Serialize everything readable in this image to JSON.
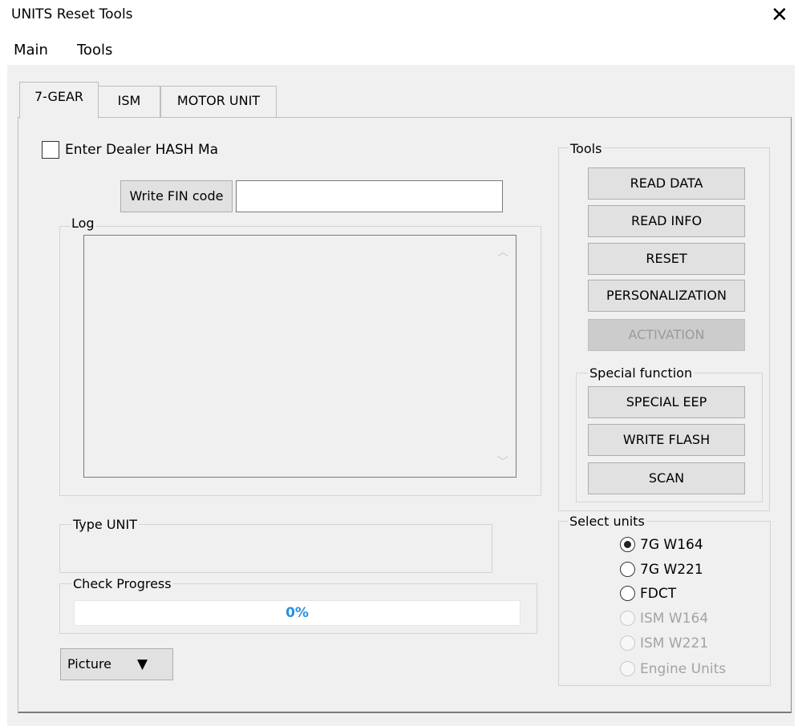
{
  "window": {
    "title": "UNITS Reset Tools",
    "close_label": "✕"
  },
  "menu": {
    "items": [
      "Main",
      "Tools"
    ]
  },
  "tabs": [
    "7-GEAR",
    "ISM",
    "MOTOR UNIT"
  ],
  "checkbox": {
    "label": "Enter Dealer HASH Ma",
    "checked": false
  },
  "write_fin": {
    "button_label": "Write FIN code",
    "value": ""
  },
  "log": {
    "label": "Log",
    "content": ""
  },
  "tools": {
    "label": "Tools",
    "buttons": [
      "READ DATA",
      "READ INFO",
      "RESET",
      "PERSONALIZATION",
      "ACTIVATION"
    ],
    "disabled": [
      "ACTIVATION"
    ]
  },
  "special": {
    "label": "Special function",
    "buttons": [
      "SPECIAL EEP",
      "WRITE FLASH",
      "SCAN"
    ]
  },
  "type_unit": {
    "label": "Type UNIT"
  },
  "progress": {
    "label": "Check Progress",
    "text": "0%",
    "value": 0
  },
  "picture_button": {
    "label": "Picture"
  },
  "select_units": {
    "label": "Select units",
    "options": [
      "7G W164",
      "7G W221",
      "FDCT",
      "ISM W164",
      "ISM W221",
      "Engine Units"
    ],
    "selected": "7G W164",
    "disabled": [
      "ISM W164",
      "ISM W221",
      "Engine Units"
    ]
  },
  "colors": {
    "accent": "#2c8fe0",
    "window_bg": "#f0f0f0",
    "button_bg": "#e1e1e1"
  }
}
